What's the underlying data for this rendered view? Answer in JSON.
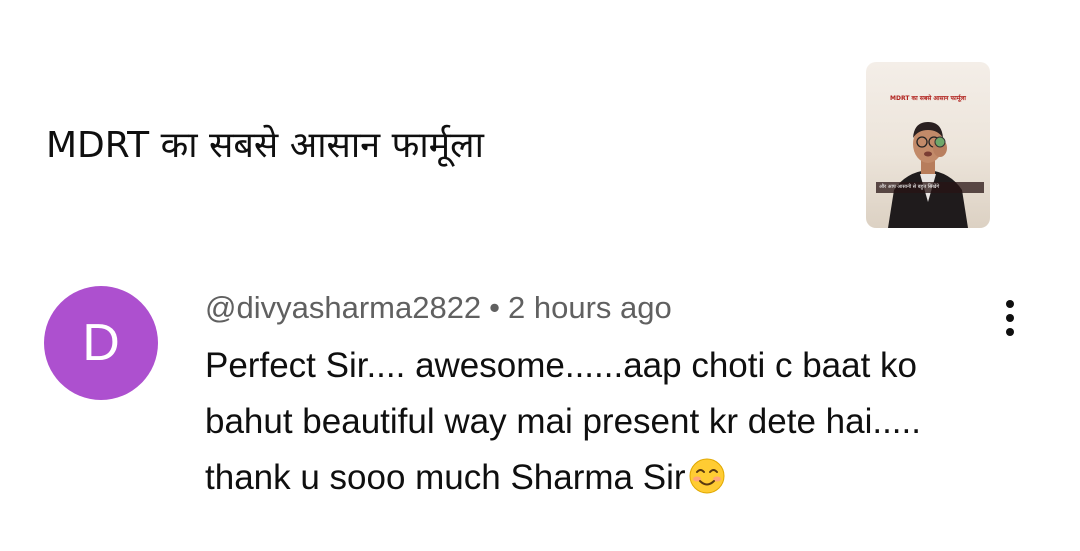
{
  "video": {
    "title": "MDRT का सबसे आसान फार्मूला",
    "thumbnail": {
      "title_text": "MDRT का सबसे आसान फार्मूला",
      "caption_text": "और आप आसानी से बहुत सिखेंगे"
    }
  },
  "comment": {
    "avatar_letter": "D",
    "avatar_color": "#ad50cf",
    "author": "@divyasharma2822",
    "separator": "•",
    "time": "2 hours ago",
    "text_lines": [
      "Perfect Sir.... awesome......aap choti c baat ko",
      "bahut beautiful way mai present kr dete hai.....",
      "thank u sooo much Sharma Sir"
    ],
    "emoji": "smiling-face-icon",
    "menu_icon": "more-vertical-icon"
  }
}
